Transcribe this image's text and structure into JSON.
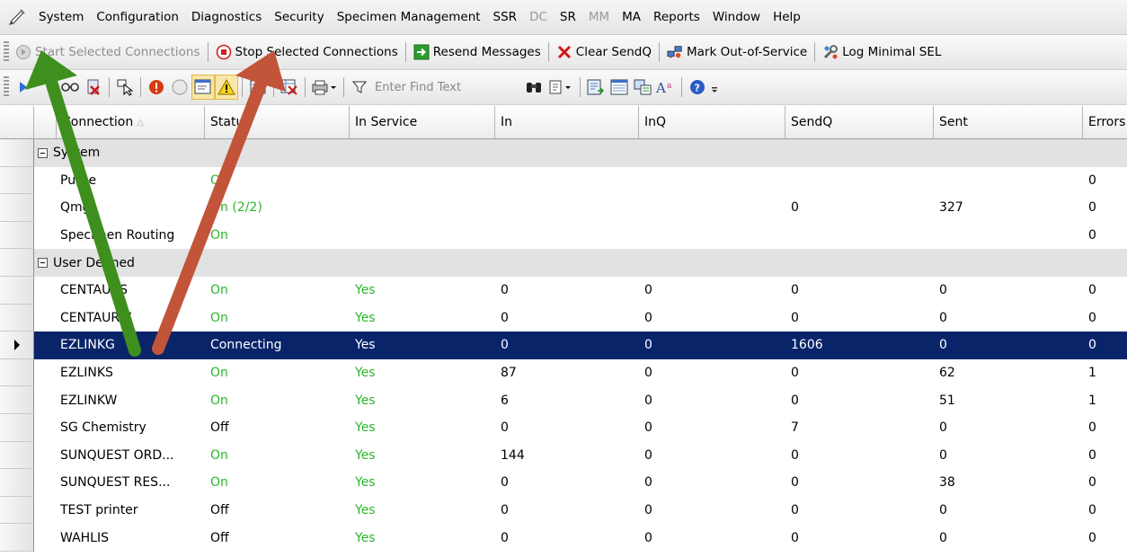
{
  "menu": [
    "System",
    "Configuration",
    "Diagnostics",
    "Security",
    "Specimen Management",
    "SSR",
    "DC",
    "SR",
    "MM",
    "MA",
    "Reports",
    "Window",
    "Help"
  ],
  "menu_disabled": [
    "DC",
    "MM"
  ],
  "toolbar1": {
    "start": "Start Selected Connections",
    "stop": "Stop Selected Connections",
    "resend": "Resend Messages",
    "clear": "Clear SendQ",
    "mark": "Mark Out-of-Service",
    "log": "Log Minimal SEL"
  },
  "toolbar2": {
    "find_placeholder": "Enter Find Text"
  },
  "columns": [
    "Connection",
    "Status",
    "In Service",
    "In",
    "InQ",
    "SendQ",
    "Sent",
    "Errors"
  ],
  "groups": [
    {
      "name": "System",
      "rows": [
        {
          "connection": "Purge",
          "status": "On",
          "in_service": "",
          "in": "",
          "inq": "",
          "sendq": "",
          "sent": "",
          "errors": "0"
        },
        {
          "connection": "Qmgr",
          "status": "On (2/2)",
          "in_service": "",
          "in": "",
          "inq": "",
          "sendq": "0",
          "sent": "327",
          "errors": "0"
        },
        {
          "connection": "Specimen Routing",
          "status": "On",
          "in_service": "",
          "in": "",
          "inq": "",
          "sendq": "",
          "sent": "",
          "errors": "0"
        }
      ]
    },
    {
      "name": "User Defined",
      "rows": [
        {
          "connection": "CENTAURS",
          "status": "On",
          "in_service": "Yes",
          "in": "0",
          "inq": "0",
          "sendq": "0",
          "sent": "0",
          "errors": "0"
        },
        {
          "connection": "CENTAURW",
          "status": "On",
          "in_service": "Yes",
          "in": "0",
          "inq": "0",
          "sendq": "0",
          "sent": "0",
          "errors": "0"
        },
        {
          "connection": "EZLINKG",
          "status": "Connecting",
          "in_service": "Yes",
          "in": "0",
          "inq": "0",
          "sendq": "1606",
          "sent": "0",
          "errors": "0",
          "selected": true
        },
        {
          "connection": "EZLINKS",
          "status": "On",
          "in_service": "Yes",
          "in": "87",
          "inq": "0",
          "sendq": "0",
          "sent": "62",
          "errors": "1"
        },
        {
          "connection": "EZLINKW",
          "status": "On",
          "in_service": "Yes",
          "in": "6",
          "inq": "0",
          "sendq": "0",
          "sent": "51",
          "errors": "1"
        },
        {
          "connection": "SG Chemistry",
          "status": "Off",
          "in_service": "Yes",
          "in": "0",
          "inq": "0",
          "sendq": "7",
          "sent": "0",
          "errors": "0"
        },
        {
          "connection": "SUNQUEST ORD...",
          "status": "On",
          "in_service": "Yes",
          "in": "144",
          "inq": "0",
          "sendq": "0",
          "sent": "0",
          "errors": "0"
        },
        {
          "connection": "SUNQUEST RES...",
          "status": "On",
          "in_service": "Yes",
          "in": "0",
          "inq": "0",
          "sendq": "0",
          "sent": "38",
          "errors": "0"
        },
        {
          "connection": "TEST printer",
          "status": "Off",
          "in_service": "Yes",
          "in": "0",
          "inq": "0",
          "sendq": "0",
          "sent": "0",
          "errors": "0"
        },
        {
          "connection": "WAHLIS",
          "status": "Off",
          "in_service": "Yes",
          "in": "0",
          "inq": "0",
          "sendq": "0",
          "sent": "0",
          "errors": "0"
        }
      ]
    }
  ],
  "colors": {
    "on_green": "#2db52d",
    "selection": "#0a246a",
    "arrow_green": "#3f8f1f",
    "arrow_red": "#c2543a"
  }
}
